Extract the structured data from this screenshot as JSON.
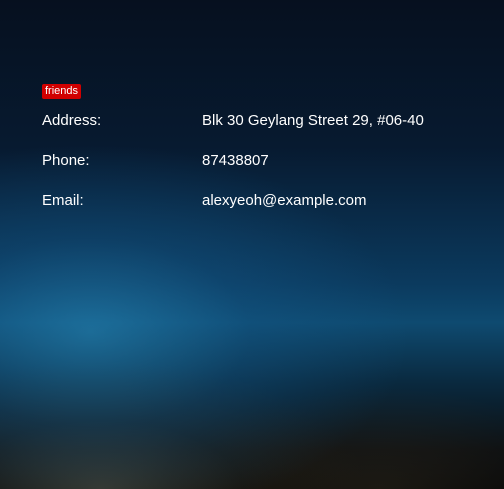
{
  "tags": [
    "friends"
  ],
  "details": [
    {
      "label": "Address:",
      "value": "Blk 30 Geylang Street 29, #06-40"
    },
    {
      "label": "Phone:",
      "value": "87438807"
    },
    {
      "label": "Email:",
      "value": "alexyeoh@example.com"
    }
  ],
  "colors": {
    "tag_background": "#d10000",
    "text": "#ffffff"
  }
}
